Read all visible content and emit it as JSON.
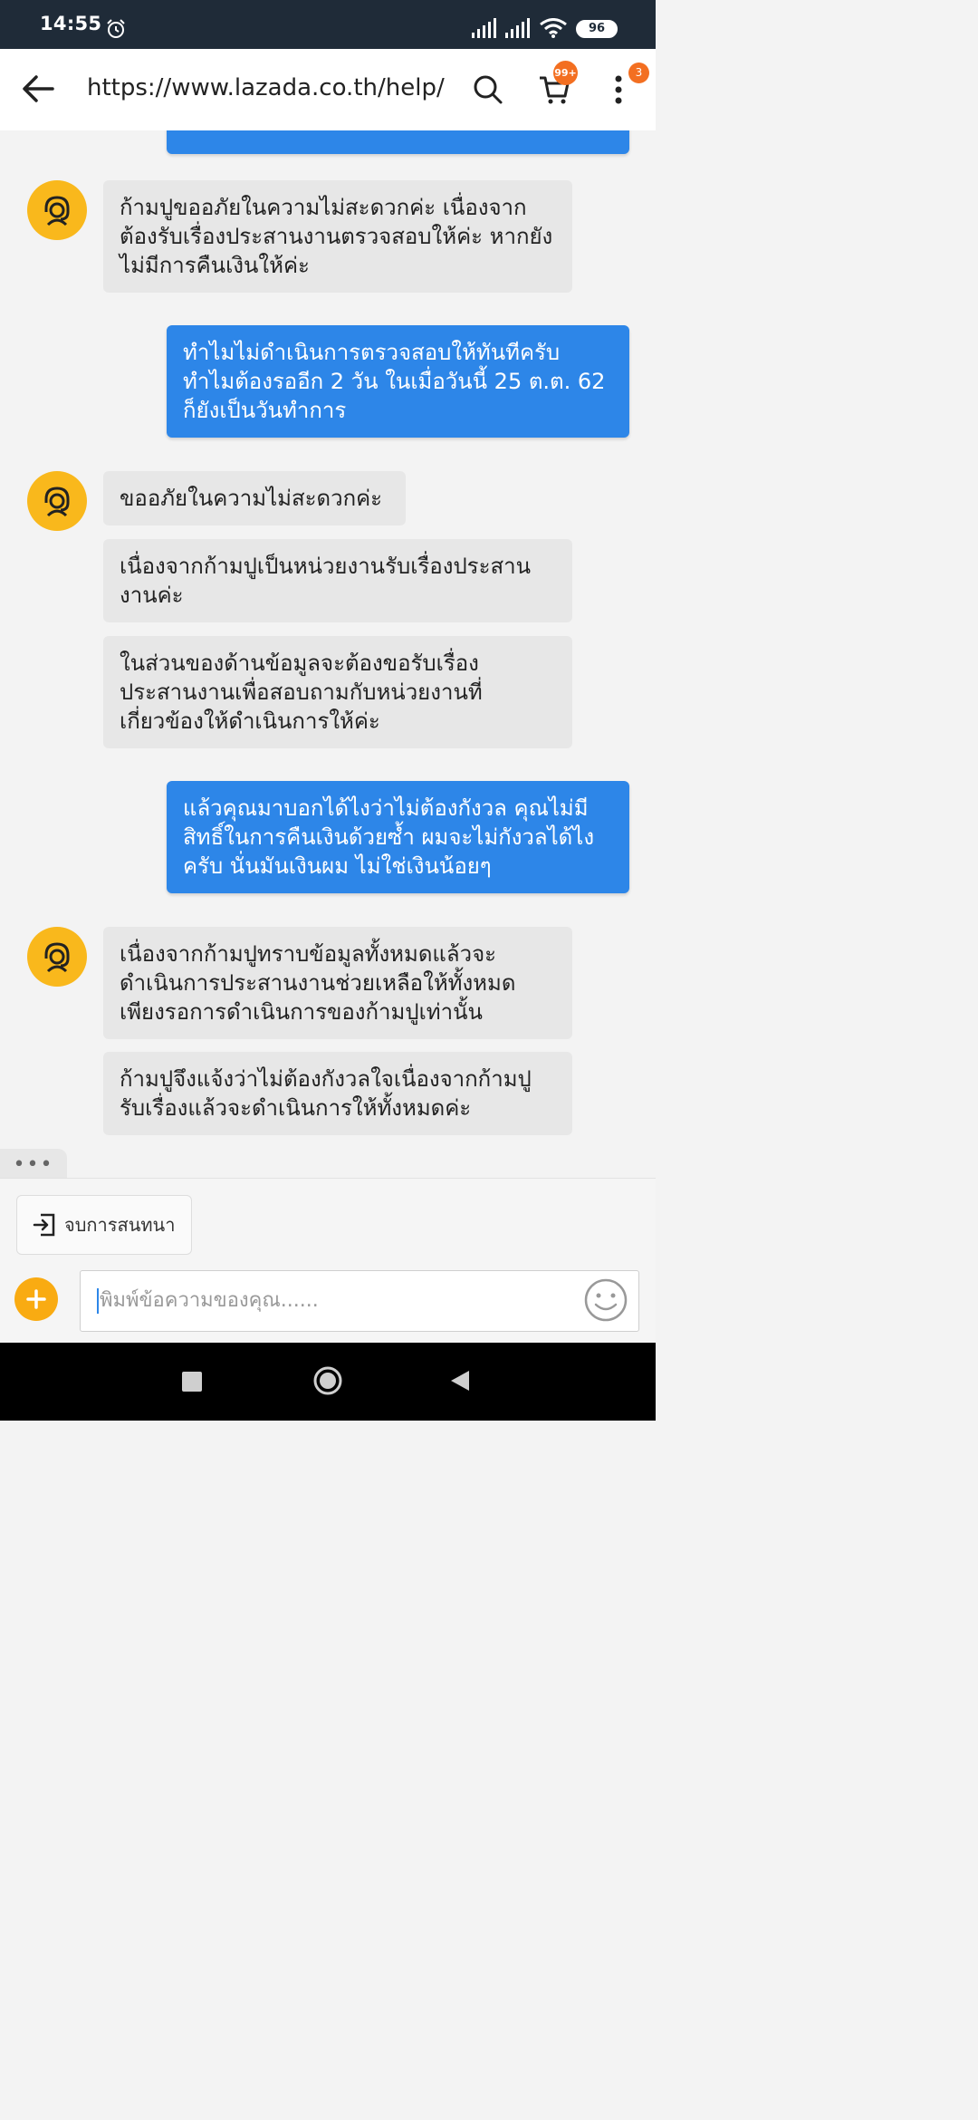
{
  "status_bar": {
    "time": "14:55",
    "battery": "96",
    "icons": [
      "alarm-icon",
      "signal-icon",
      "signal-icon",
      "wifi-icon",
      "battery-icon"
    ]
  },
  "toolbar": {
    "url": "https://www.lazada.co.th/help/",
    "cart_badge": "99+",
    "menu_badge": "3",
    "icons": [
      "back-arrow-icon",
      "search-icon",
      "cart-icon",
      "more-vert-icon"
    ]
  },
  "chat": {
    "messages": [
      {
        "from": "agent",
        "text": "ก้ามปูขออภัยในความไม่สะดวกค่ะ เนื่องจากต้องรับเรื่องประสานงานตรวจสอบให้ค่ะ หากยังไม่มีการคืนเงินให้ค่ะ"
      },
      {
        "from": "user",
        "text": "ทำไมไม่ดำเนินการตรวจสอบให้ทันทีครับ ทำไมต้องรออีก 2 วัน ในเมื่อวันนี้ 25 ต.ต. 62 ก็ยังเป็นวันทำการ"
      },
      {
        "from": "agent",
        "text": "ขออภัยในความไม่สะดวกค่ะ"
      },
      {
        "from": "agent",
        "text": "เนื่องจากก้ามปูเป็นหน่วยงานรับเรื่องประสานงานค่ะ"
      },
      {
        "from": "agent",
        "text": "ในส่วนของด้านข้อมูลจะต้องขอรับเรื่องประสานงานเพื่อสอบถามกับหน่วยงานที่เกี่ยวข้องให้ดำเนินการให้ค่ะ"
      },
      {
        "from": "user",
        "text": "แล้วคุณมาบอกได้ไงว่าไม่ต้องกังวล คุณไม่มีสิทธิ์ในการคืนเงินด้วยซ้ำ ผมจะไม่กังวลได้ไงครับ นั่นมันเงินผม ไม่ใช่เงินน้อยๆ"
      },
      {
        "from": "agent",
        "text": "เนื่องจากก้ามปูทราบข้อมูลทั้งหมดแล้วจะดำเนินการประสานงานช่วยเหลือให้ทั้งหมด เพียงรอการดำเนินการของก้ามปูเท่านั้น"
      },
      {
        "from": "agent",
        "text": "ก้ามปูจึงแจ้งว่าไม่ต้องกังวลใจเนื่องจากก้ามปูรับเรื่องแล้วจะดำเนินการให้ทั้งหมดค่ะ"
      }
    ],
    "typing_indicator": "•••"
  },
  "composer": {
    "end_chat_label": "จบการสนทนา",
    "input_placeholder": "พิมพ์ข้อความของคุณ......",
    "icons": [
      "exit-icon",
      "plus-icon",
      "emoji-icon"
    ]
  },
  "colors": {
    "user_bubble": "#2d86e8",
    "agent_bubble": "#e7e7e7",
    "avatar": "#f9b81c",
    "badge": "#f36f21",
    "status_bar": "#1f2b38"
  }
}
